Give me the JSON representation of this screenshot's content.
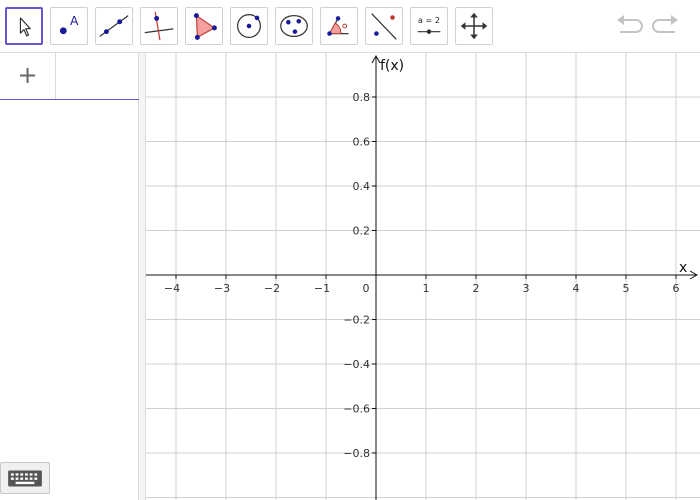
{
  "toolbar": {
    "tools": [
      {
        "name": "move-tool",
        "icon": "cursor-arrow-icon",
        "selected": true
      },
      {
        "name": "point-tool",
        "icon": "point-icon",
        "label": "A"
      },
      {
        "name": "line-tool",
        "icon": "line-through-points-icon"
      },
      {
        "name": "perpendicular-line-tool",
        "icon": "perpendicular-line-icon"
      },
      {
        "name": "polygon-tool",
        "icon": "polygon-icon"
      },
      {
        "name": "circle-tool",
        "icon": "circle-center-point-icon"
      },
      {
        "name": "conic-tool",
        "icon": "ellipse-through-points-icon"
      },
      {
        "name": "angle-tool",
        "icon": "angle-icon"
      },
      {
        "name": "reflect-tool",
        "icon": "reflect-about-line-icon"
      },
      {
        "name": "slider-tool",
        "icon": "slider-icon",
        "label": "a = 2"
      },
      {
        "name": "move-graphics-tool",
        "icon": "move-arrows-icon"
      }
    ],
    "undo": "undo-icon",
    "redo": "redo-icon"
  },
  "algebra": {
    "add_label": "+"
  },
  "axes": {
    "x_label": "x",
    "y_label": "f(x)",
    "x_ticks": [
      "−4",
      "−3",
      "−2",
      "−1",
      "0",
      "1",
      "2",
      "3",
      "4",
      "5",
      "6"
    ],
    "y_ticks": [
      "0.8",
      "0.6",
      "0.4",
      "0.2",
      "−0.2",
      "−0.4",
      "−0.6",
      "−0.8"
    ]
  },
  "colors": {
    "accent": "#6557d2",
    "grid": "#d0d0d0",
    "point": "#1a1a99",
    "polygon_fill": "#f4a0a0",
    "red": "#c0392b"
  }
}
